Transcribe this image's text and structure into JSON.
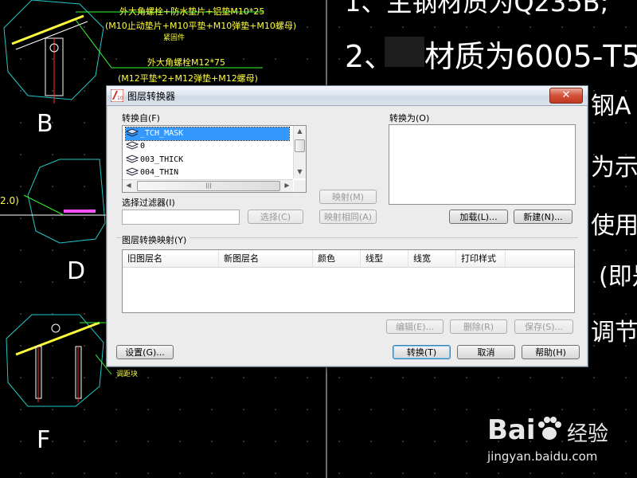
{
  "background": {
    "cad_annotations": [
      "外大角螺栓+防水垫片+铝垫M10*25",
      "(M10止动垫片+M10平垫+M10弹垫+M10螺母)",
      "紧固件",
      "外大角螺栓M12*75",
      "(M12平垫*2+M12弹垫+M12螺母)",
      "2.0)",
      "调距块"
    ],
    "section_labels": [
      "B",
      "D",
      "F"
    ],
    "right_notes": [
      "1、主钢材质为Q235B;",
      "2、",
      "材质为6005-T5",
      "钢A",
      "为示意",
      "使用长",
      "(即是",
      "调节,"
    ],
    "watermark": {
      "brand": "Bai",
      "brand_suffix": "经验",
      "url": "jingyan.baidu.com"
    }
  },
  "dialog": {
    "title": "图层转换器",
    "close_symbol": "✕",
    "convert_from": {
      "label": "转换自(F)",
      "layers": [
        "_TCH_MASK",
        "0",
        "003_THICK",
        "004_THIN"
      ],
      "selected_index": 0,
      "filter_label": "选择过滤器(I)",
      "filter_value": "",
      "select_button": "选择(C)"
    },
    "middle": {
      "map_button": "映射(M)",
      "map_same_button": "映射相同(A)"
    },
    "convert_to": {
      "label": "转换为(O)",
      "load_button": "加载(L)...",
      "new_button": "新建(N)..."
    },
    "mapping": {
      "label": "图层转换映射(Y)",
      "columns": [
        "旧图层名",
        "新图层名",
        "颜色",
        "线型",
        "线宽",
        "打印样式"
      ],
      "edit_button": "编辑(E)...",
      "delete_button": "删除(R)",
      "save_button": "保存(S)..."
    },
    "footer": {
      "settings_button": "设置(G)...",
      "convert_button": "转换(T)",
      "cancel_button": "取消",
      "help_button": "帮助(H)"
    },
    "scroll": {
      "up": "▲",
      "down": "▼",
      "left": "◀",
      "right": "▶",
      "grip": "|||"
    }
  }
}
